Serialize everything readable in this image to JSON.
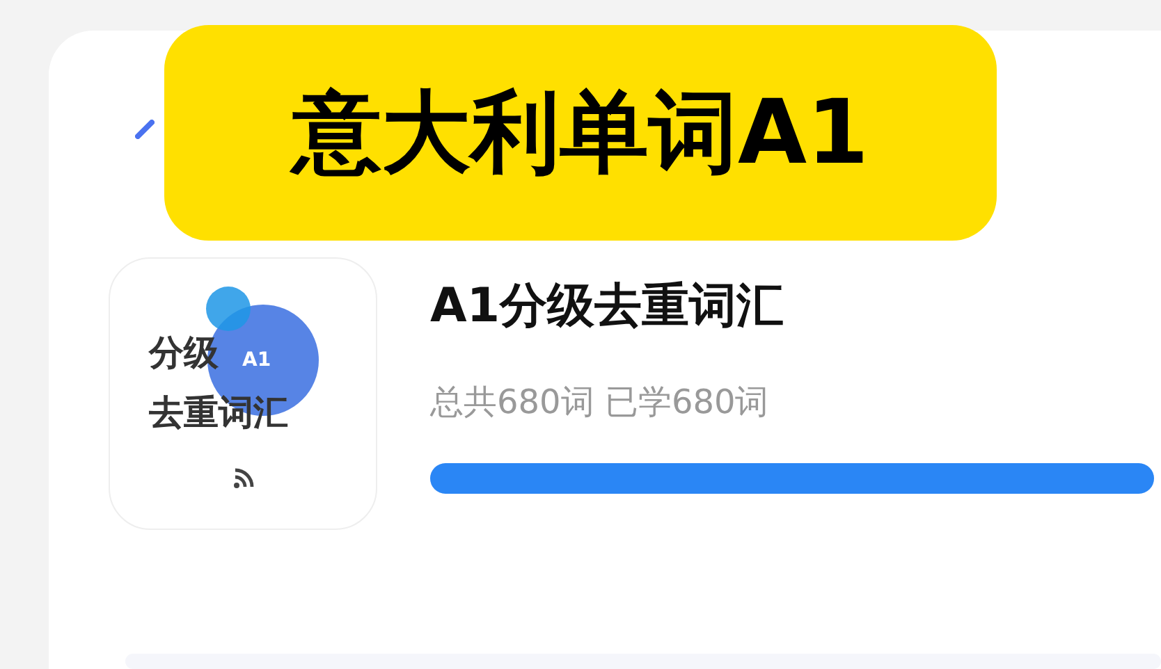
{
  "banner": {
    "title": "意大利单词A1"
  },
  "book": {
    "cover": {
      "line_1": "分级",
      "badge": "A1",
      "line_2": "去重词汇"
    },
    "title": "A1分级去重词汇",
    "stats": "总共680词 已学680词",
    "progress": {
      "level": 1
    }
  }
}
